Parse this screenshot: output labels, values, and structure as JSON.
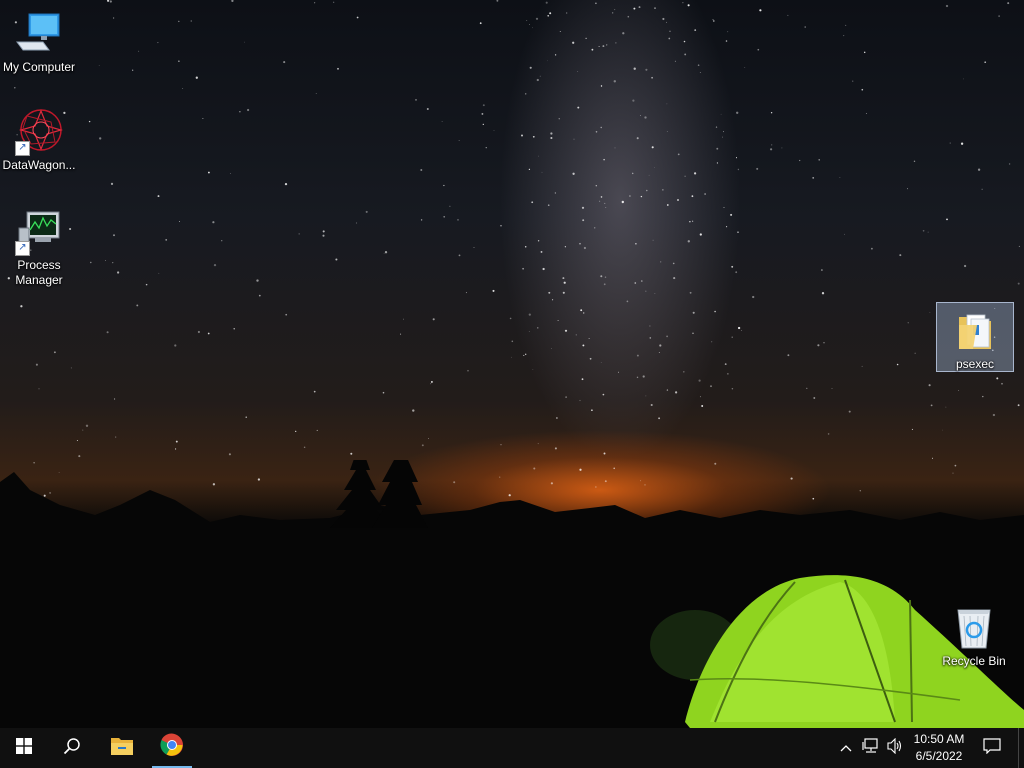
{
  "desktop": {
    "icons": [
      {
        "label": "My Computer"
      },
      {
        "label": "DataWagon..."
      },
      {
        "label": "Process\nManager"
      },
      {
        "label": "psexec"
      },
      {
        "label": "Recycle Bin"
      }
    ]
  },
  "taskbar": {
    "start_icon": "windows-logo-icon",
    "search_icon": "search-icon",
    "pinned": [
      "file-explorer-icon",
      "chrome-icon"
    ],
    "tray": {
      "chevron_icon": "chevron-up-icon",
      "network_icon": "network-icon",
      "volume_icon": "volume-icon",
      "notification_icon": "action-center-icon"
    },
    "clock": {
      "time": "10:50 AM",
      "date": "6/5/2022"
    }
  },
  "colors": {
    "taskbar_bg": "#101010",
    "active_indicator": "#76b9ed",
    "selection": "#96aac8"
  }
}
